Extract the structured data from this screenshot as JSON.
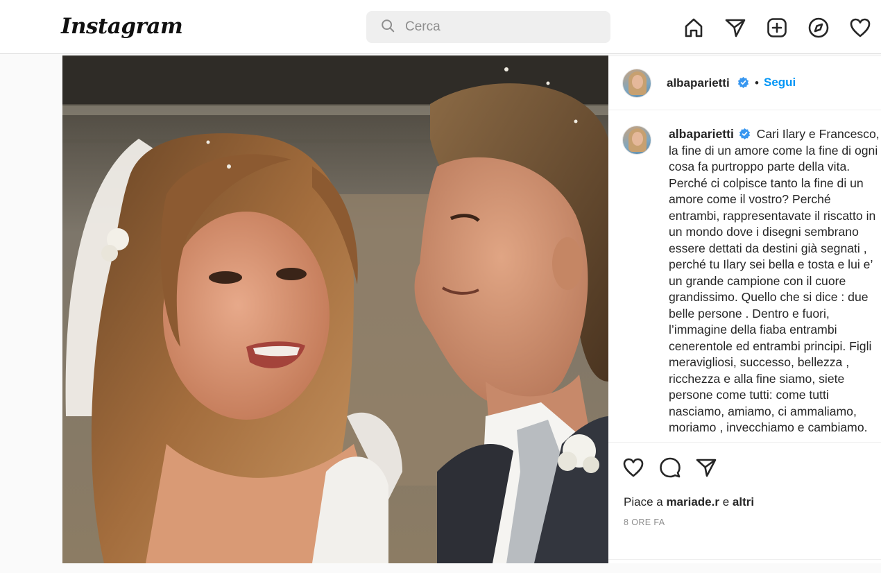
{
  "topbar": {
    "logo": "Instagram",
    "search_placeholder": "Cerca",
    "nav_icons": [
      "home-icon",
      "direct-message-icon",
      "new-post-icon",
      "explore-icon",
      "activity-heart-icon"
    ]
  },
  "post": {
    "author": "albaparietti",
    "follow_label": "Segui",
    "separator": "•",
    "caption": "Cari Ilary e Francesco, la fine di un amore come la fine di ogni cosa fa purtroppo parte della vita. Perché ci colpisce tanto la fine di un amore come il vostro? Perché entrambi, rappresentavate il riscatto in un mondo dove i disegni sembrano essere dettati da destini già segnati , perché tu Ilary sei bella e tosta e lui e’ un grande campione con il cuore grandissimo. Quello che si dice : due belle persone . Dentro e fuori, l’immagine della fiaba entrambi cenerentole ed entrambi principi. Figli meravigliosi, successo, bellezza , ricchezza e alla fine siamo, siete persone come tutti: come tutti nasciamo, amiamo, ci ammaliamo, moriamo , invecchiamo e cambiamo.",
    "likes_prefix": "Piace a",
    "likes_user": "mariade.r",
    "likes_conj": "e",
    "likes_others": "altri",
    "timestamp": "8 ORE FA",
    "action_icons": [
      "like-heart-icon",
      "comment-icon",
      "share-icon"
    ]
  },
  "colors": {
    "accent": "#0095f6",
    "text": "#262626",
    "muted": "#8e8e8e",
    "border": "#dbdbdb"
  }
}
